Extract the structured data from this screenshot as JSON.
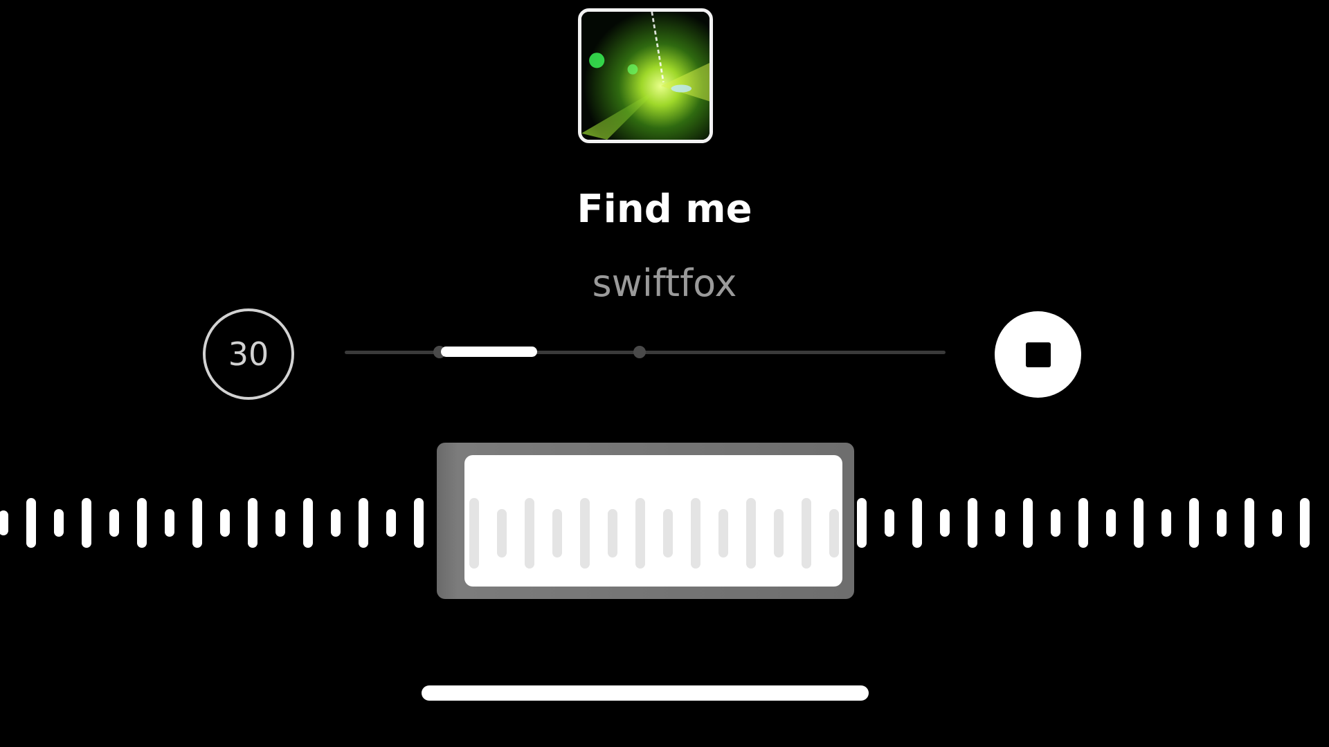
{
  "track": {
    "title": "Find me",
    "artist": "swiftfox"
  },
  "duration_button": {
    "label": "30"
  },
  "scrubber": {
    "progress_start_fraction": 0.16,
    "progress_end_fraction": 0.32
  },
  "waveform": {
    "bar_heights": [
      0.5,
      1.0,
      0.55,
      1.0,
      0.55,
      1.0,
      0.55,
      1.0,
      0.55,
      1.0,
      0.55,
      1.0,
      0.55,
      1.0,
      0.55,
      1.0,
      0.55,
      1.0,
      0.55,
      1.0,
      0.55,
      1.0,
      0.55,
      1.0,
      0.55,
      1.0,
      0.55,
      1.0,
      0.55,
      1.0,
      0.55,
      1.0,
      0.55,
      1.0,
      0.55,
      1.0,
      0.55,
      1.0,
      0.55,
      1.0,
      0.55,
      1.0,
      0.55,
      1.0,
      0.55,
      1.0,
      0.55,
      1.0
    ]
  },
  "icons": {
    "album": "album-art",
    "stop": "stop-icon"
  },
  "colors": {
    "background": "#000000",
    "primary": "#ffffff",
    "secondary_text": "#9a9a9a"
  }
}
